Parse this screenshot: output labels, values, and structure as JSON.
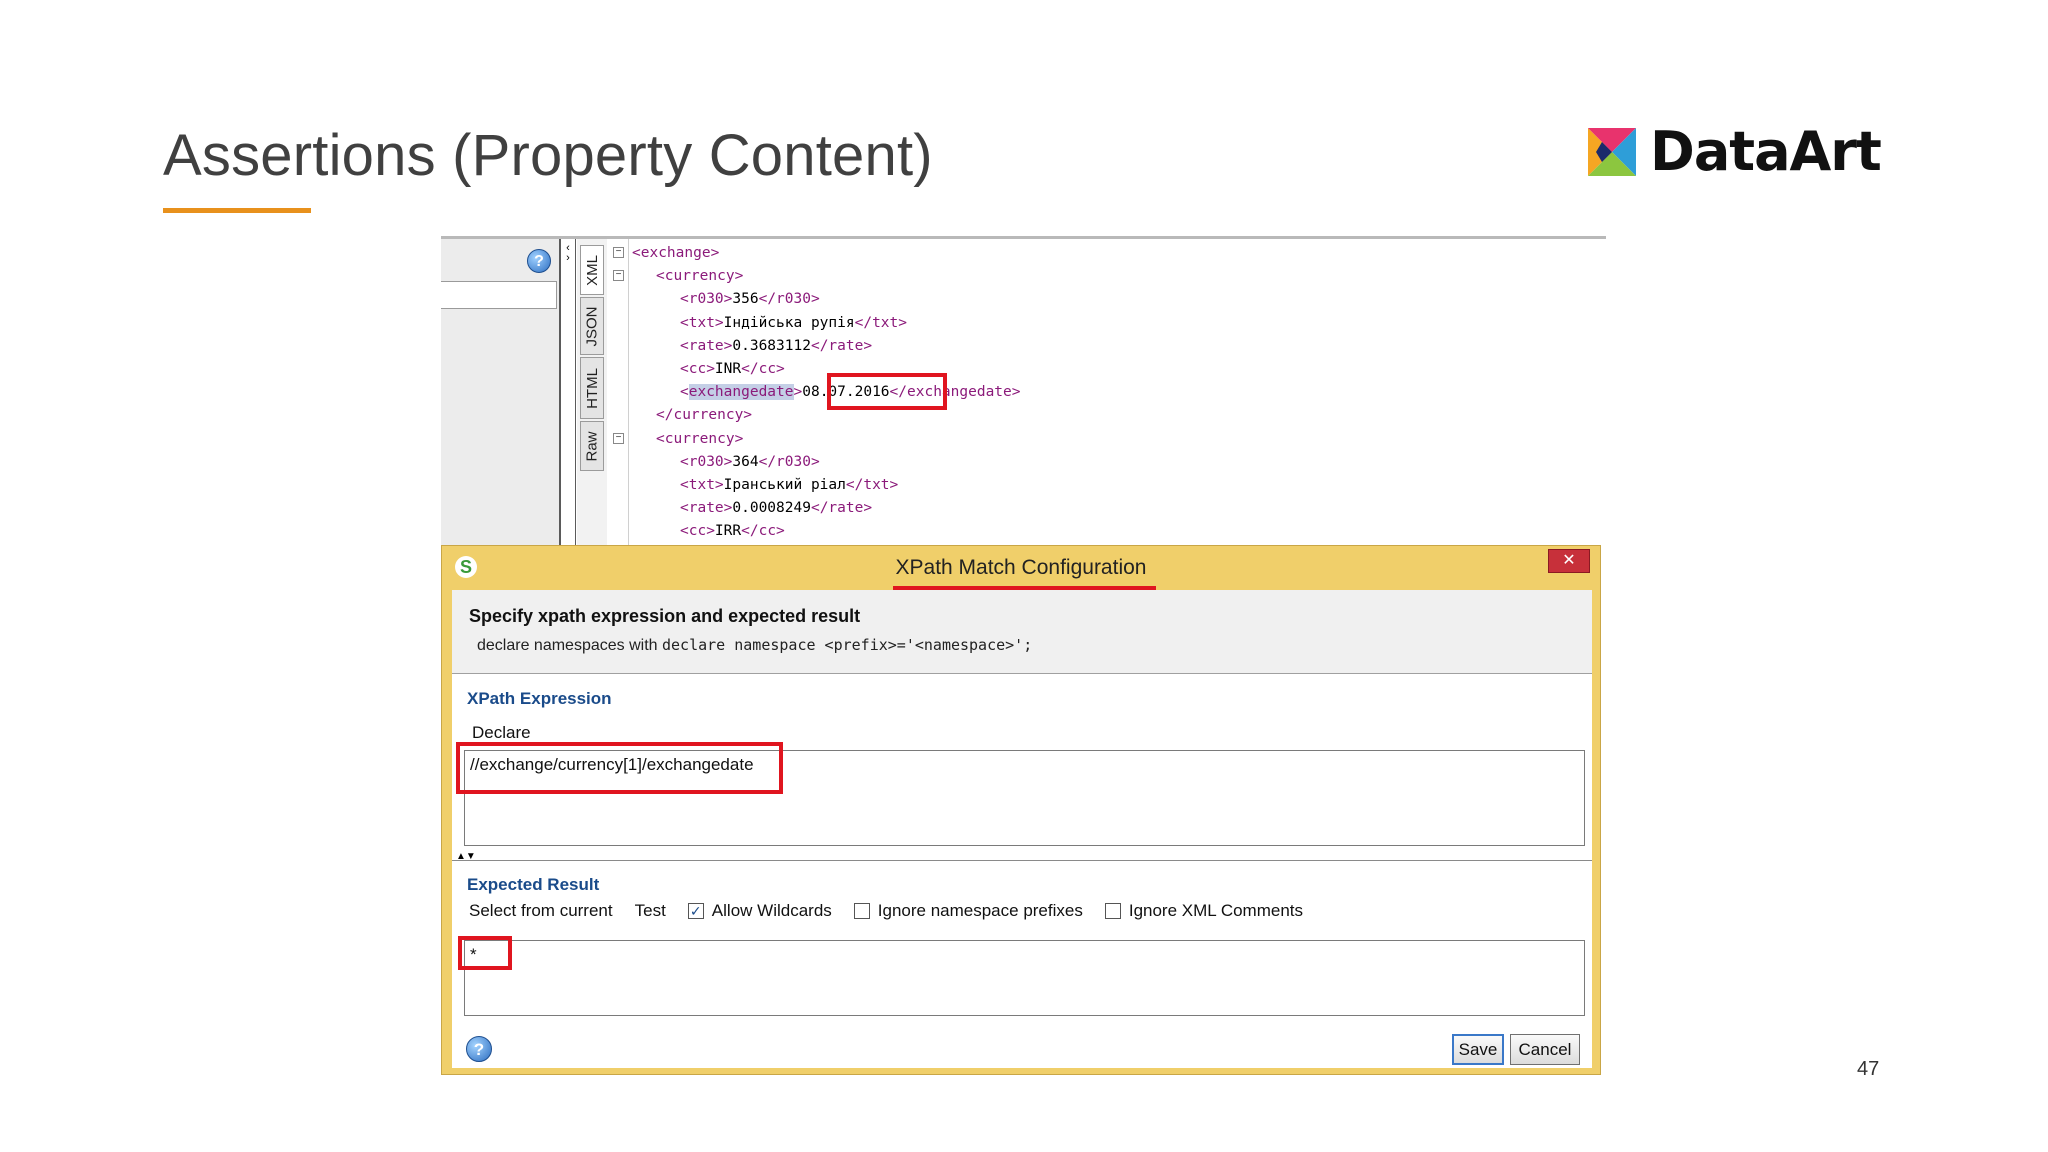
{
  "slide": {
    "title": "Assertions (Property Content)",
    "page_number": "47"
  },
  "logo": {
    "text": "DataArt",
    "colors": [
      "#f5a623",
      "#e8336d",
      "#2e9ed8",
      "#8cc63f",
      "#1b2a6b"
    ]
  },
  "editor": {
    "tabs": [
      "XML",
      "JSON",
      "HTML",
      "Raw"
    ],
    "active_tab": "XML",
    "xml_lines": [
      {
        "indent": 0,
        "open": "<",
        "tag": "exchange",
        "close": ">",
        "text": ""
      },
      {
        "indent": 1,
        "open": "<",
        "tag": "currency",
        "close": ">",
        "text": ""
      },
      {
        "indent": 2,
        "tag_open": "<r030>",
        "value": "356",
        "tag_close": "</r030>"
      },
      {
        "indent": 2,
        "tag_open": "<txt>",
        "value": "Індійська рупія",
        "tag_close": "</txt>"
      },
      {
        "indent": 2,
        "tag_open": "<rate>",
        "value": "0.3683112",
        "tag_close": "</rate>"
      },
      {
        "indent": 2,
        "tag_open": "<cc>",
        "value": "INR",
        "tag_close": "</cc>"
      },
      {
        "indent": 2,
        "tag_open": "<exchangedate>",
        "value": "08.07.2016",
        "tag_close": "</exchangedate>"
      },
      {
        "indent": 1,
        "open": "</",
        "tag": "currency",
        "close": ">",
        "text": ""
      },
      {
        "indent": 1,
        "open": "<",
        "tag": "currency",
        "close": ">",
        "text": ""
      },
      {
        "indent": 2,
        "tag_open": "<r030>",
        "value": "364",
        "tag_close": "</r030>"
      },
      {
        "indent": 2,
        "tag_open": "<txt>",
        "value": "Іранський ріал",
        "tag_close": "</txt>"
      },
      {
        "indent": 2,
        "tag_open": "<rate>",
        "value": "0.0008249",
        "tag_close": "</rate>"
      },
      {
        "indent": 2,
        "tag_open": "<cc>",
        "value": "IRR",
        "tag_close": "</cc>"
      }
    ]
  },
  "dialog": {
    "title": "XPath Match Configuration",
    "close_label": "✕",
    "heading": "Specify xpath expression and expected result",
    "hint_prefix": "declare namespaces with ",
    "hint_code": "declare namespace <prefix>='<namespace>';",
    "xpath_section": "XPath Expression",
    "declare_label": "Declare",
    "xpath_value": "//exchange/currency[1]/exchangedate",
    "expected_section": "Expected Result",
    "select_from_current": "Select from current",
    "test_label": "Test",
    "checkboxes": [
      {
        "label": "Allow Wildcards",
        "checked": true
      },
      {
        "label": "Ignore namespace prefixes",
        "checked": false
      },
      {
        "label": "Ignore XML Comments",
        "checked": false
      }
    ],
    "expected_value": "*",
    "save_label": "Save",
    "cancel_label": "Cancel"
  }
}
